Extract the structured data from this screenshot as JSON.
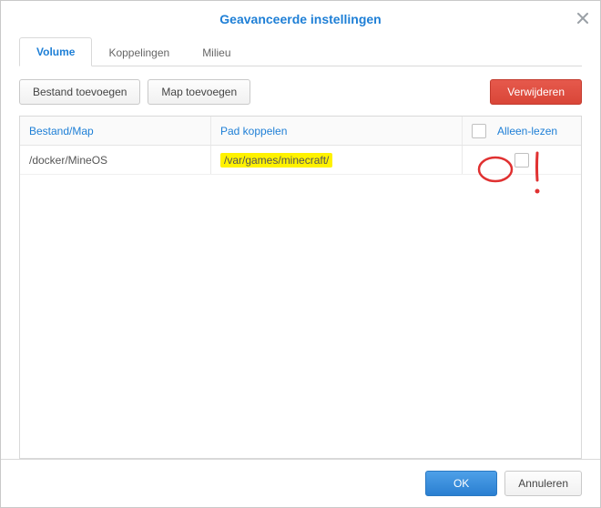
{
  "dialog": {
    "title": "Geavanceerde instellingen"
  },
  "tabs": {
    "volume": "Volume",
    "links": "Koppelingen",
    "env": "Milieu"
  },
  "toolbar": {
    "add_file": "Bestand toevoegen",
    "add_folder": "Map toevoegen",
    "delete": "Verwijderen"
  },
  "columns": {
    "file_folder": "Bestand/Map",
    "mount_path": "Pad koppelen",
    "read_only": "Alleen-lezen"
  },
  "rows": [
    {
      "file": "/docker/MineOS",
      "path": "/var/games/minecraft/",
      "readonly": false
    }
  ],
  "footer": {
    "ok": "OK",
    "cancel": "Annuleren"
  }
}
